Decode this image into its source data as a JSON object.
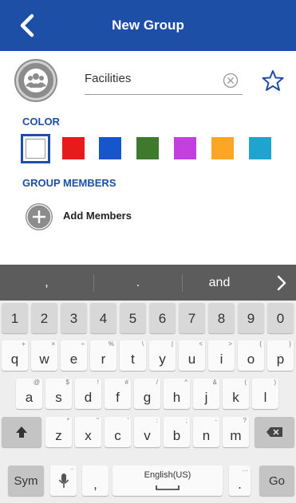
{
  "header": {
    "title": "New Group",
    "back_icon": "chevron-left-icon",
    "background": "#1e4fa6"
  },
  "group": {
    "name": "Facilities",
    "avatar_icon": "group-icon",
    "clear_icon": "clear-circle-icon",
    "favorite_icon": "star-outline-icon"
  },
  "color_section": {
    "label": "COLOR",
    "selected": "#ffffff",
    "swatches": [
      "#ffffff",
      "#e81a1a",
      "#1655cc",
      "#3d7a2b",
      "#c23fe0",
      "#fba624",
      "#1fa3cf"
    ]
  },
  "members_section": {
    "label": "GROUP MEMBERS",
    "add_label": "Add Members",
    "add_icon": "plus-circle-icon"
  },
  "keyboard": {
    "suggestions": [
      ",",
      ".",
      "and"
    ],
    "suggestion_next_icon": "chevron-right-icon",
    "number_row": [
      "1",
      "2",
      "3",
      "4",
      "5",
      "6",
      "7",
      "8",
      "9",
      "0"
    ],
    "row1": [
      [
        "q",
        "+"
      ],
      [
        "w",
        "×"
      ],
      [
        "e",
        "÷"
      ],
      [
        "r",
        "%"
      ],
      [
        "t",
        "\\"
      ],
      [
        "y",
        "|"
      ],
      [
        "u",
        "<"
      ],
      [
        "i",
        ">"
      ],
      [
        "o",
        "{"
      ],
      [
        "p",
        "}"
      ]
    ],
    "row2": [
      [
        "a",
        "@"
      ],
      [
        "s",
        "$"
      ],
      [
        "d",
        "!"
      ],
      [
        "f",
        "#"
      ],
      [
        "g",
        "/"
      ],
      [
        "h",
        "^"
      ],
      [
        "j",
        "&"
      ],
      [
        "k",
        "("
      ],
      [
        "l",
        ")"
      ]
    ],
    "row3": [
      [
        "z",
        "*"
      ],
      [
        "x",
        "\""
      ],
      [
        "c",
        "'"
      ],
      [
        "v",
        ":"
      ],
      [
        "b",
        ";"
      ],
      [
        "n",
        "-"
      ],
      [
        "m",
        "?"
      ]
    ],
    "shift_icon": "shift-arrow-icon",
    "backspace_icon": "backspace-icon",
    "sym_label": "Sym",
    "mic_icon": "microphone-icon",
    "comma": ",",
    "space_label": "English(US)",
    "period": ".",
    "period_sub": "…",
    "go_label": "Go"
  }
}
